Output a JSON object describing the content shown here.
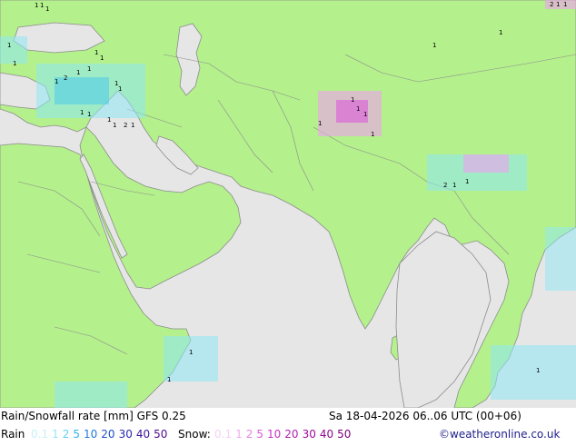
{
  "map": {
    "colors": {
      "sea": "#e6e6e6",
      "land": "#b4f08c",
      "border": "#8c8c8c",
      "rain_light": "#8ee7f6",
      "rain_medium": "#46c8f0",
      "snow_light": "#f0a0f0",
      "snow_medium": "#dc50dc"
    },
    "labels": [
      "1",
      "1",
      "1",
      "2",
      "1",
      "1",
      "1",
      "1",
      "1",
      "1",
      "1",
      "1",
      "1",
      "2",
      "1",
      "1",
      "1",
      "1",
      "1",
      "1",
      "1",
      "1",
      "2",
      "1",
      "1",
      "1",
      "1",
      "1",
      "1",
      "1",
      "2",
      "1",
      "1",
      "1",
      "1"
    ]
  },
  "footer": {
    "title": "Rain/Snowfall rate [mm] GFS 0.25",
    "datetime": "Sa 18-04-2026 06..06 UTC (00+06)",
    "rain_label": "Rain",
    "rain_values": [
      "0.1",
      "1",
      "2",
      "5",
      "10",
      "20",
      "30",
      "40",
      "50"
    ],
    "rain_colors": [
      "#c8f0f8",
      "#96e6f5",
      "#64d2f0",
      "#32b4eb",
      "#1e78dc",
      "#1e50c8",
      "#2828b4",
      "#3c14a0",
      "#500a8c"
    ],
    "snow_label": "Snow:",
    "snow_values": [
      "0.1",
      "1",
      "2",
      "5",
      "10",
      "20",
      "30",
      "40",
      "50"
    ],
    "snow_colors": [
      "#f5d2f5",
      "#f0aaf0",
      "#e682e6",
      "#dc5adc",
      "#c832c8",
      "#b41eb4",
      "#a00aa0",
      "#8c0a8c",
      "#780078"
    ],
    "credit": "©weatheronline.co.uk",
    "credit_color": "#1e1e8c"
  }
}
